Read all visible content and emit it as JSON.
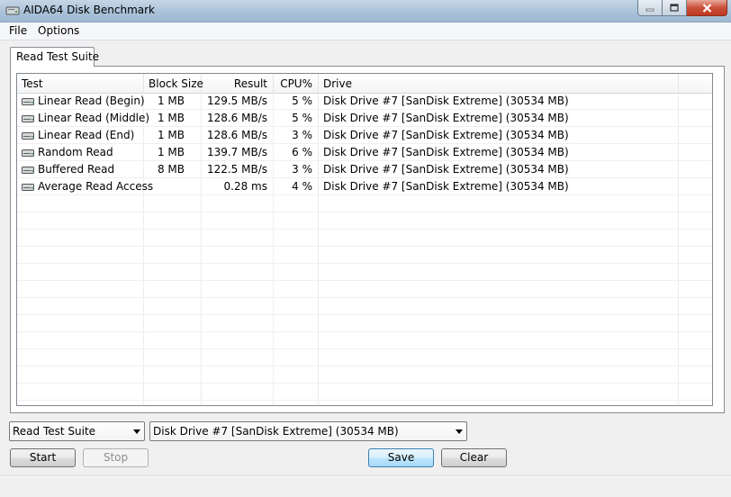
{
  "window": {
    "title": "AIDA64 Disk Benchmark"
  },
  "menu": {
    "file": "File",
    "options": "Options"
  },
  "tab": {
    "label": "Read Test Suite"
  },
  "columns": {
    "test": "Test",
    "block_size": "Block Size",
    "result": "Result",
    "cpu": "CPU%",
    "drive": "Drive"
  },
  "rows": [
    {
      "test": "Linear Read (Begin)",
      "block_size": "1 MB",
      "result": "129.5 MB/s",
      "cpu": "5 %",
      "drive": "Disk Drive #7  [SanDisk Extreme]  (30534 MB)"
    },
    {
      "test": "Linear Read (Middle)",
      "block_size": "1 MB",
      "result": "128.6 MB/s",
      "cpu": "5 %",
      "drive": "Disk Drive #7  [SanDisk Extreme]  (30534 MB)"
    },
    {
      "test": "Linear Read (End)",
      "block_size": "1 MB",
      "result": "128.6 MB/s",
      "cpu": "3 %",
      "drive": "Disk Drive #7  [SanDisk Extreme]  (30534 MB)"
    },
    {
      "test": "Random Read",
      "block_size": "1 MB",
      "result": "139.7 MB/s",
      "cpu": "6 %",
      "drive": "Disk Drive #7  [SanDisk Extreme]  (30534 MB)"
    },
    {
      "test": "Buffered Read",
      "block_size": "8 MB",
      "result": "122.5 MB/s",
      "cpu": "3 %",
      "drive": "Disk Drive #7  [SanDisk Extreme]  (30534 MB)"
    },
    {
      "test": "Average Read Access",
      "block_size": "",
      "result": "0.28 ms",
      "cpu": "4 %",
      "drive": "Disk Drive #7  [SanDisk Extreme]  (30534 MB)"
    }
  ],
  "controls": {
    "suite_selected": "Read Test Suite",
    "drive_selected": "Disk Drive #7  [SanDisk Extreme]  (30534 MB)",
    "start": "Start",
    "stop": "Stop",
    "save": "Save",
    "clear": "Clear"
  },
  "icons": {
    "app": "disk-benchmark-icon",
    "row": "hard-disk-icon"
  },
  "colors": {
    "title_bar": "#a9c1d8",
    "close_button": "#c9503b",
    "default_button_border": "#3c7fb1"
  }
}
